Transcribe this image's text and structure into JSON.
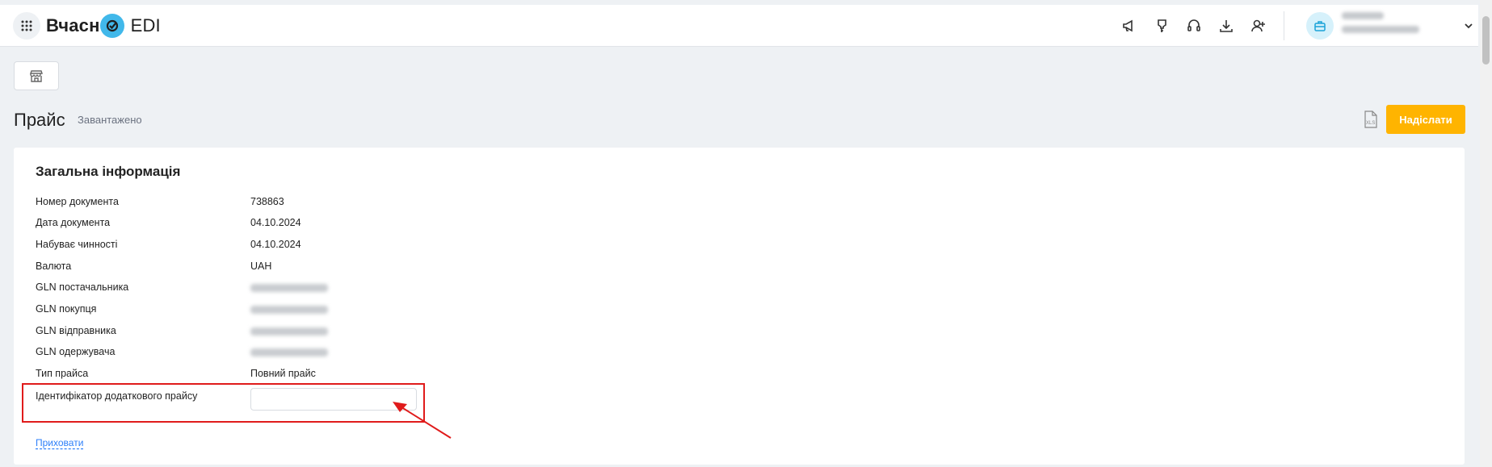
{
  "header": {
    "logo_text_left": "Вчасн",
    "logo_text_right": "EDI",
    "icons": [
      "megaphone-icon",
      "lightbulb-icon",
      "headset-icon",
      "download-icon",
      "add-user-icon"
    ]
  },
  "page": {
    "title": "Прайс",
    "status": "Завантажено",
    "send_label": "Надіслати",
    "export_icon": "xls-file-icon"
  },
  "general_info": {
    "title": "Загальна інформація",
    "rows": [
      {
        "label": "Номер документа",
        "value": "738863"
      },
      {
        "label": "Дата документа",
        "value": "04.10.2024"
      },
      {
        "label": "Набуває чинності",
        "value": "04.10.2024"
      },
      {
        "label": "Валюта",
        "value": "UAH"
      },
      {
        "label": "GLN постачальника",
        "value": ""
      },
      {
        "label": "GLN покупця",
        "value": ""
      },
      {
        "label": "GLN відправника",
        "value": ""
      },
      {
        "label": "GLN одержувача",
        "value": ""
      },
      {
        "label": "Тип прайса",
        "value": "Повний прайс"
      }
    ],
    "additional_id_label": "Ідентифікатор додаткового прайсу",
    "additional_id_value": "",
    "hide_link": "Приховати"
  },
  "colors": {
    "accent_yellow": "#ffb400",
    "logo_blue": "#41b8ea",
    "annotation_red": "#e01b1b",
    "link_blue": "#2d7ff9"
  }
}
